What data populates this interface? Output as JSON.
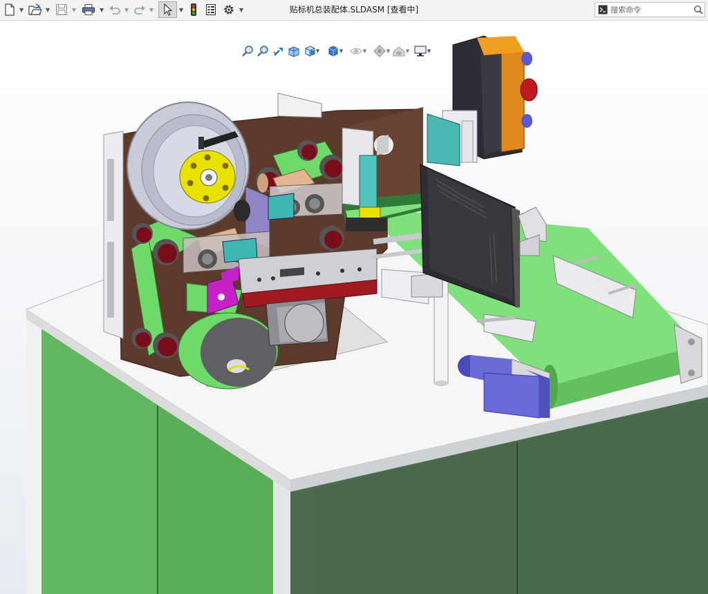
{
  "window": {
    "title": "贴标机总装配体.SLDASM [查看中]"
  },
  "toolbar": {
    "buttons": [
      {
        "icon": "new-document-icon",
        "has_dropdown": true
      },
      {
        "icon": "open-folder-icon",
        "has_dropdown": true
      },
      {
        "icon": "save-icon",
        "has_dropdown": true,
        "disabled": true
      },
      {
        "icon": "print-icon",
        "has_dropdown": true
      },
      {
        "icon": "undo-icon",
        "has_dropdown": true,
        "disabled": true
      },
      {
        "icon": "redo-icon",
        "has_dropdown": true,
        "disabled": true
      },
      {
        "icon": "select-pointer-icon",
        "has_dropdown": true,
        "selected": true
      },
      {
        "icon": "traffic-light-icon"
      },
      {
        "icon": "file-properties-icon"
      },
      {
        "icon": "options-gear-icon",
        "has_dropdown": true
      }
    ]
  },
  "search": {
    "placeholder": "搜索命令",
    "value": ""
  },
  "heads_up_toolbar": {
    "buttons": [
      "zoom-to-fit-icon",
      "zoom-to-area-icon",
      "previous-view-icon",
      "section-view-icon",
      "view-orientation-icon",
      "display-style-icon",
      "hide-show-items-icon",
      "edit-appearance-icon",
      "apply-scene-icon",
      "view-settings-icon"
    ]
  },
  "model": {
    "name": "label-machine-assembly",
    "colors": {
      "cabinet_green": "#5cb15a",
      "cabinet_dark_green": "#4a6a4e",
      "table_top": "#f4f4f4",
      "back_plate": "#5b3a2c",
      "conveyor_green": "#7ce07a",
      "roller_red": "#7a0e1c",
      "spool_yellow": "#e6e000",
      "motor_blue": "#6c6cd8",
      "control_box_black": "#2d2d35",
      "control_box_orange": "#e08a1e",
      "label_bar_red": "#a01a22",
      "magenta_part": "#c223c8",
      "teal_slider": "#4ac0b8",
      "steel": "#c8c8d0"
    }
  }
}
